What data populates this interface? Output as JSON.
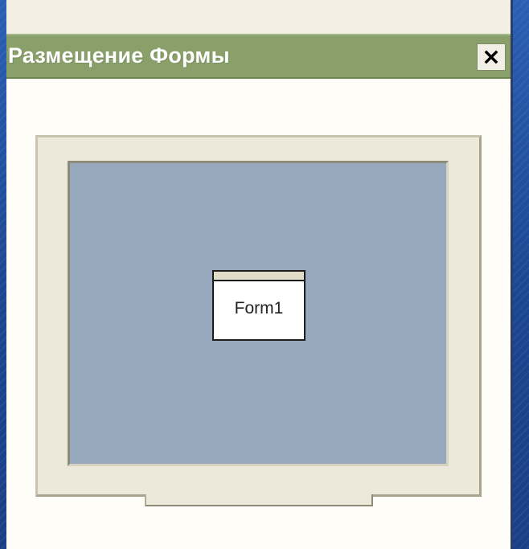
{
  "window": {
    "title": "Размещение Формы",
    "close_icon": "close-icon"
  },
  "preview": {
    "form_label": "Form1"
  },
  "colors": {
    "titlebar": "#8aa06a",
    "screen": "#97a8bd",
    "monitor_frame": "#ece8da",
    "panel_background": "#fbfaf3",
    "desktop_background": "#1f4e9a"
  }
}
